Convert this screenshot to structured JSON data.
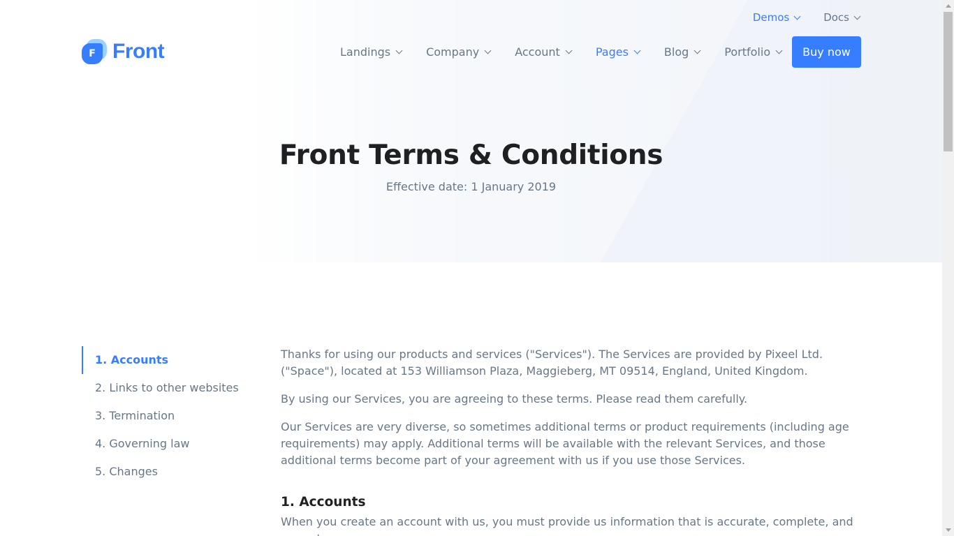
{
  "topbar": {
    "items": [
      {
        "label": "Demos",
        "active": true
      },
      {
        "label": "Docs",
        "active": false
      }
    ]
  },
  "brand": {
    "logo_letter": "F",
    "name": "Front",
    "accent_color": "#377dff"
  },
  "nav": {
    "items": [
      {
        "label": "Landings",
        "active": false
      },
      {
        "label": "Company",
        "active": false
      },
      {
        "label": "Account",
        "active": false
      },
      {
        "label": "Pages",
        "active": true
      },
      {
        "label": "Blog",
        "active": false
      },
      {
        "label": "Portfolio",
        "active": false
      }
    ],
    "cta_label": "Buy now"
  },
  "hero": {
    "title": "Front Terms & Conditions",
    "subtitle": "Effective date: 1 January 2019"
  },
  "toc": {
    "items": [
      {
        "label": "1. Accounts",
        "active": true
      },
      {
        "label": "2. Links to other websites",
        "active": false
      },
      {
        "label": "3. Termination",
        "active": false
      },
      {
        "label": "4. Governing law",
        "active": false
      },
      {
        "label": "5. Changes",
        "active": false
      }
    ]
  },
  "content": {
    "intro_1": "Thanks for using our products and services (\"Services\"). The Services are provided by Pixeel Ltd. (\"Space\"), located at 153 Williamson Plaza, Maggieberg, MT 09514, England, United Kingdom.",
    "intro_2": "By using our Services, you are agreeing to these terms. Please read them carefully.",
    "intro_3": "Our Services are very diverse, so sometimes additional terms or product requirements (including age requirements) may apply. Additional terms will be available with the relevant Services, and those additional terms become part of your agreement with us if you use those Services.",
    "section_1_title": "1. Accounts",
    "section_1_text": "When you create an account with us, you must provide us information that is accurate, complete, and current"
  }
}
